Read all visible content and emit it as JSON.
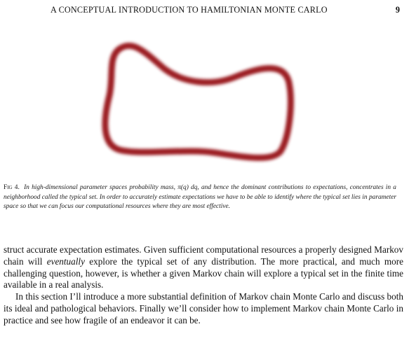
{
  "header": {
    "running_title": "A CONCEPTUAL INTRODUCTION TO HAMILTONIAN MONTE CARLO",
    "page_number": "9"
  },
  "figure": {
    "curve_color": "#9b1c22",
    "caption_label": "Fig 4.",
    "caption_text": "In high-dimensional parameter spaces probability mass, π(q) dq, and hence the dominant contributions to expectations, concentrates in a neighborhood called the typical set. In order to accurately estimate expectations we have to be able to identify where the typical set lies in parameter space so that we can focus our computational resources where they are most effective."
  },
  "body": {
    "p1_before": "struct accurate expectation estimates. Given sufficient computational resources a properly designed Markov chain will ",
    "p1_emph": "eventually",
    "p1_after": " explore the typical set of any distribution. The more practical, and much more challenging question, however, is whether a given Markov chain will explore a typical set in the finite time available in a real analysis.",
    "p2": "In this section I’ll introduce a more substantial definition of Markov chain Monte Carlo and discuss both its ideal and pathological behaviors. Finally we’ll consider how to implement Markov chain Monte Carlo in practice and see how fragile of an endeavor it can be."
  }
}
